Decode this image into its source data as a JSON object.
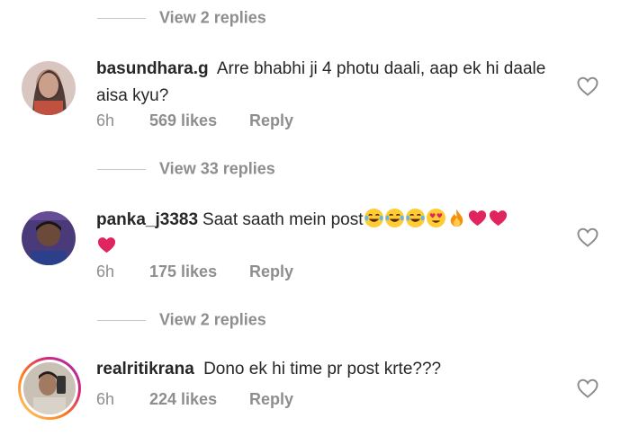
{
  "view_replies": [
    {
      "label": "View 2 replies"
    },
    {
      "label": "View 33 replies"
    },
    {
      "label": "View 2 replies"
    }
  ],
  "comments": [
    {
      "username": "basundhara.g",
      "text": "Arre bhabhi ji 4 photu daali, aap ek hi daale aisa kyu?",
      "time": "6h",
      "likes": "569 likes",
      "reply_label": "Reply"
    },
    {
      "username": "panka_j3383",
      "text": "Saat saath mein post",
      "emojis": [
        "laughing-tears-emoji",
        "laughing-tears-emoji",
        "laughing-tears-emoji",
        "heart-eyes-emoji",
        "fire-emoji",
        "red-heart-emoji",
        "red-heart-emoji",
        "red-heart-emoji"
      ],
      "time": "6h",
      "likes": "175 likes",
      "reply_label": "Reply"
    },
    {
      "username": "realritikrana",
      "text": "Dono ek hi time pr post krte???",
      "time": "6h",
      "likes": "224 likes",
      "reply_label": "Reply"
    }
  ],
  "colors": {
    "text_primary": "#262626",
    "text_secondary": "#8e8e8e",
    "divider": "#c7c7c7",
    "emoji_heart": "#e0245e",
    "emoji_face": "#ffcc33"
  }
}
